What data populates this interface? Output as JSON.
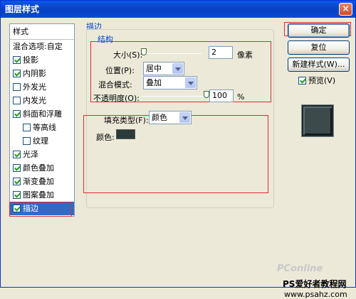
{
  "window": {
    "title": "图层样式",
    "close": "×"
  },
  "stylelist": {
    "header": "样式",
    "blend_options": "混合选项:自定",
    "items": [
      {
        "label": "投影",
        "checked": true
      },
      {
        "label": "内阴影",
        "checked": true
      },
      {
        "label": "外发光",
        "checked": false
      },
      {
        "label": "内发光",
        "checked": false
      },
      {
        "label": "斜面和浮雕",
        "checked": true
      },
      {
        "label": "等高线",
        "checked": false
      },
      {
        "label": "纹理",
        "checked": false
      },
      {
        "label": "光泽",
        "checked": true
      },
      {
        "label": "颜色叠加",
        "checked": true
      },
      {
        "label": "渐变叠加",
        "checked": true
      },
      {
        "label": "图案叠加",
        "checked": true
      },
      {
        "label": "描边",
        "checked": true,
        "selected": true
      }
    ]
  },
  "stroke": {
    "title": "描边",
    "structure_title": "结构",
    "size_label": "大小(S):",
    "size_value": "2",
    "size_unit": "像素",
    "position_label": "位置(P):",
    "position_value": "居中",
    "blend_label": "混合模式:",
    "blend_value": "叠加",
    "opacity_label": "不透明度(O):",
    "opacity_value": "100",
    "opacity_unit": "%",
    "fill_type_label": "填充类型(F):",
    "fill_type_value": "颜色",
    "color_label": "颜色:",
    "color_value": "#2c3a3a"
  },
  "buttons": {
    "ok": "确定",
    "reset": "复位",
    "new_style": "新建样式(W)...",
    "preview": "预览(V)"
  },
  "watermark": "PConline",
  "footer": {
    "site_name": "PS爱好者教程网",
    "site_url": "www.psahz.com"
  },
  "colors": {
    "accent": "#0046d5",
    "highlight_box": "#e32a35",
    "selection": "#316ac5"
  }
}
